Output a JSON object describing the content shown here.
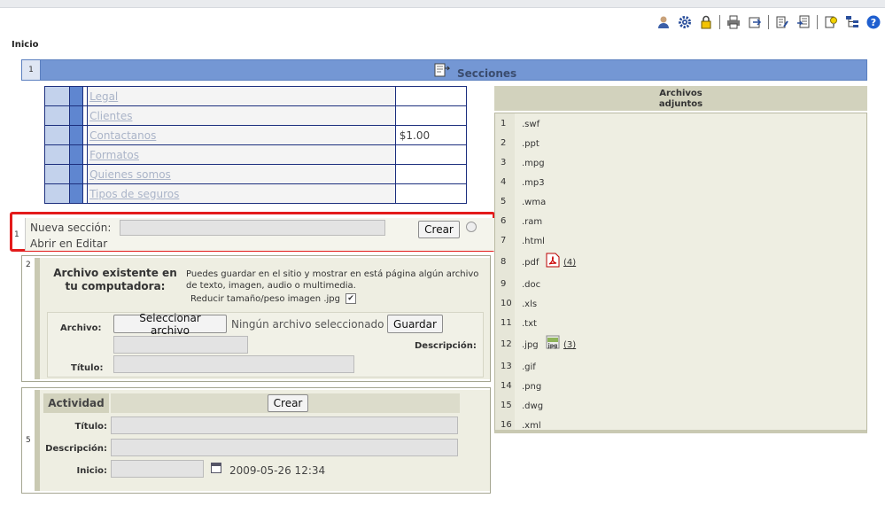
{
  "breadcrumb": "Inicio",
  "toolbar": {
    "icons": [
      "user-icon",
      "gear-icon",
      "lock-icon",
      "print-icon",
      "export-icon",
      "edit-icon",
      "notes-icon",
      "idea-icon",
      "sitemap-icon",
      "help-icon"
    ]
  },
  "sections": {
    "number": "1",
    "title": "Secciones",
    "rows": [
      {
        "name": "Legal",
        "value": ""
      },
      {
        "name": "Clientes",
        "value": ""
      },
      {
        "name": "Contactanos",
        "value": "$1.00"
      },
      {
        "name": "Formatos",
        "value": ""
      },
      {
        "name": "Quienes somos",
        "value": ""
      },
      {
        "name": "Tipos de seguros",
        "value": ""
      }
    ]
  },
  "nueva": {
    "number": "1",
    "label": "Nueva sección:",
    "input_value": "",
    "button": "Crear",
    "abrir_label": "Abrir en Editar"
  },
  "archivo": {
    "number": "2",
    "title": "Archivo existente en tu computadora:",
    "description": "Puedes guardar en el sitio y mostrar en está página algún archivo de texto, imagen, audio o multimedia.",
    "reducir_label": "Reducir tamaño/peso imagen .jpg",
    "reducir_checked": "✔",
    "archivo_label": "Archivo:",
    "select_button": "Seleccionar archivo",
    "no_file": "Ningún archivo seleccionado",
    "save_button": "Guardar",
    "descripcion_label": "Descripción:",
    "titulo_label": "Título:"
  },
  "actividad": {
    "number": "5",
    "header": "Actividad",
    "button": "Crear",
    "titulo_label": "Título:",
    "descripcion_label": "Descripción:",
    "inicio_label": "Inicio:",
    "date": "2009-05-26 12:34"
  },
  "adjuntos": {
    "title": "Archivos adjuntos",
    "items": [
      {
        "n": "1",
        "ext": ".swf",
        "count": ""
      },
      {
        "n": "2",
        "ext": ".ppt",
        "count": ""
      },
      {
        "n": "3",
        "ext": ".mpg",
        "count": ""
      },
      {
        "n": "4",
        "ext": ".mp3",
        "count": ""
      },
      {
        "n": "5",
        "ext": ".wma",
        "count": ""
      },
      {
        "n": "6",
        "ext": ".ram",
        "count": ""
      },
      {
        "n": "7",
        "ext": ".html",
        "count": ""
      },
      {
        "n": "8",
        "ext": ".pdf",
        "count": "(4)"
      },
      {
        "n": "9",
        "ext": ".doc",
        "count": ""
      },
      {
        "n": "10",
        "ext": ".xls",
        "count": ""
      },
      {
        "n": "11",
        "ext": ".txt",
        "count": ""
      },
      {
        "n": "12",
        "ext": ".jpg",
        "count": "(3)"
      },
      {
        "n": "13",
        "ext": ".gif",
        "count": ""
      },
      {
        "n": "14",
        "ext": ".png",
        "count": ""
      },
      {
        "n": "15",
        "ext": ".dwg",
        "count": ""
      },
      {
        "n": "16",
        "ext": ".xml",
        "count": ""
      }
    ]
  }
}
